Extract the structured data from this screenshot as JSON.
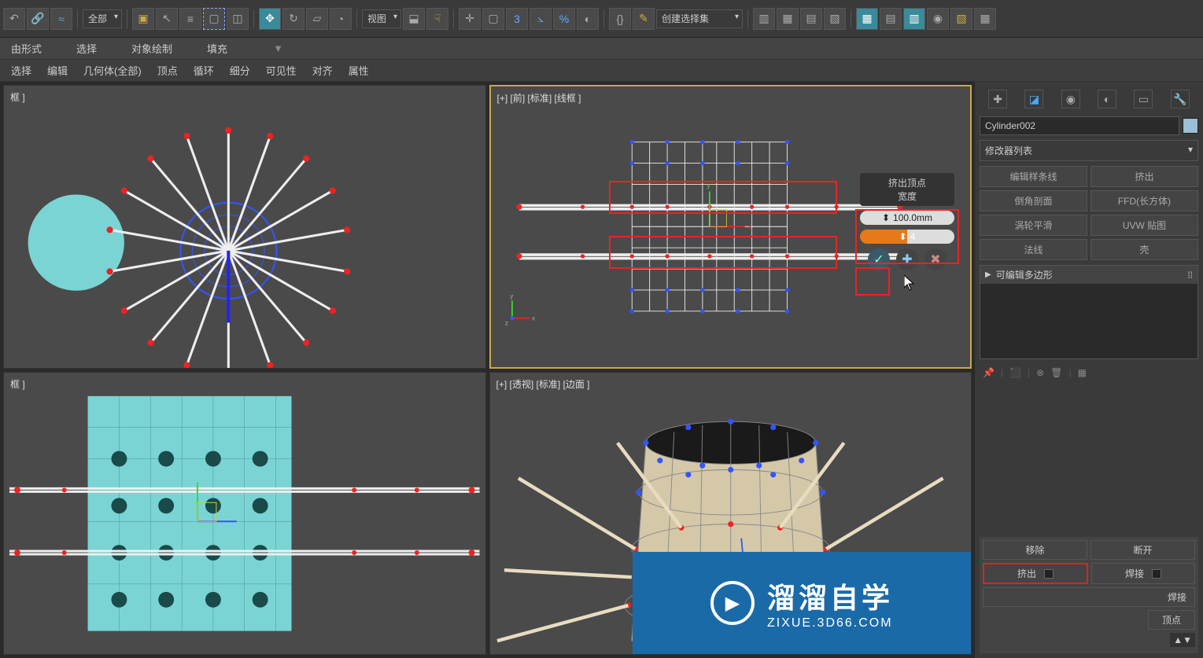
{
  "toolbar": {
    "dropdown_all": "全部",
    "dropdown_view": "视图",
    "create_set": "创建选择集"
  },
  "ribbon": {
    "row1": [
      "由形式",
      "选择",
      "对象绘制",
      "填充"
    ],
    "row2": [
      "选择",
      "编辑",
      "几何体(全部)",
      "顶点",
      "循环",
      "细分",
      "可见性",
      "对齐",
      "属性"
    ]
  },
  "viewports": {
    "tl_label": "框 ]",
    "tr_label": "[+] [前] [标准] [线框 ]",
    "bl_label": "框 ]",
    "br_label": "[+] [透视] [标准] [边面 ]"
  },
  "caddy": {
    "title": "挤出顶点\n宽度",
    "field1": "100.0mm",
    "field2": "4"
  },
  "rightpanel": {
    "object_name": "Cylinder002",
    "modifier_list": "修改器列表",
    "mods": {
      "m1": "编辑样条线",
      "m2": "挤出",
      "m3": "倒角剖面",
      "m4": "FFD(长方体)",
      "m5": "涡轮平滑",
      "m6": "UVW 贴图",
      "m7": "法线",
      "m8": "壳"
    },
    "stack_item": "可编辑多边形",
    "edit": {
      "remove": "移除",
      "break": "断开",
      "extrude": "挤出",
      "weld": "焊接",
      "weld2": "焊接",
      "vertex": "顶点"
    }
  },
  "watermark": {
    "title": "溜溜自学",
    "url": "ZIXUE.3D66.COM"
  }
}
